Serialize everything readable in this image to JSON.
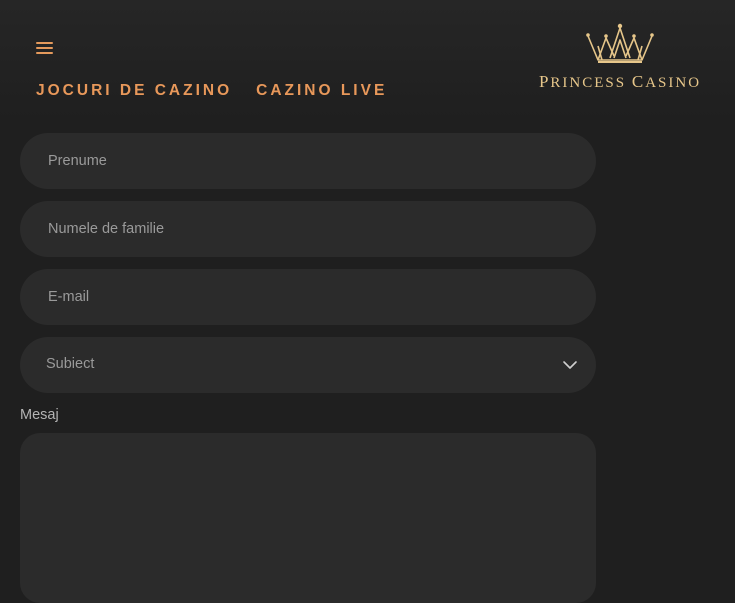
{
  "header": {
    "menu_icon": "hamburger-menu-icon",
    "faded_heading": "",
    "nav": [
      {
        "label": "JOCURI DE CAZINO"
      },
      {
        "label": "CAZINO LIVE"
      }
    ],
    "logo": {
      "icon": "crown-icon",
      "text": "Princess Casino"
    }
  },
  "form": {
    "first_name": {
      "placeholder": "Prenume",
      "value": ""
    },
    "last_name": {
      "placeholder": "Numele de familie",
      "value": ""
    },
    "email": {
      "placeholder": "E-mail",
      "value": ""
    },
    "subject": {
      "selected": "Subiect",
      "icon": "chevron-down-icon"
    },
    "message": {
      "label": "Mesaj",
      "value": ""
    }
  },
  "colors": {
    "accent": "#e8985a",
    "gold": "#e6c68a",
    "background": "#1f1f1f",
    "field": "#2b2b2b"
  }
}
